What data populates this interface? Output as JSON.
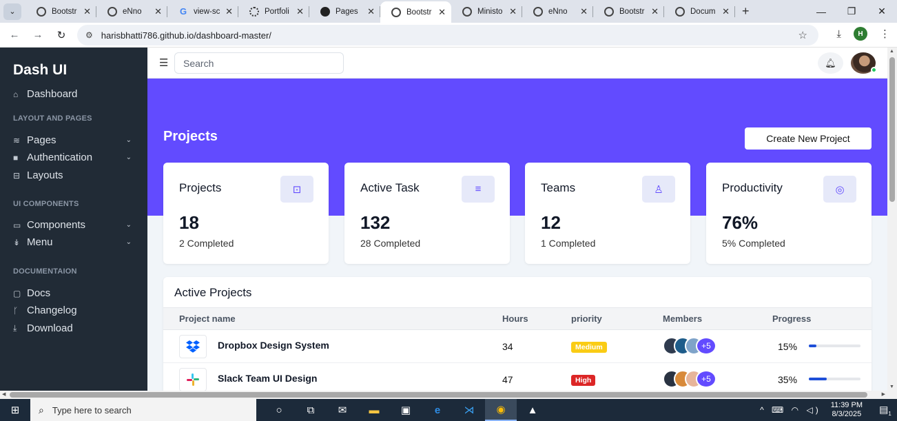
{
  "browser": {
    "tabs": [
      {
        "title": "Bootstr",
        "icon": "globe-icon"
      },
      {
        "title": "eNno",
        "icon": "globe-icon"
      },
      {
        "title": "view-sc",
        "icon": "google-icon"
      },
      {
        "title": "Portfoli",
        "icon": "portfolio-icon"
      },
      {
        "title": "Pages",
        "icon": "github-icon"
      },
      {
        "title": "Bootstr",
        "icon": "globe-icon",
        "active": true
      },
      {
        "title": "Ministo",
        "icon": "globe-icon"
      },
      {
        "title": "eNno",
        "icon": "globe-icon"
      },
      {
        "title": "Bootstr",
        "icon": "globe-icon"
      },
      {
        "title": "Docum",
        "icon": "globe-icon"
      }
    ],
    "url": "harisbhatti786.github.io/dashboard-master/",
    "profile_initial": "H"
  },
  "sidebar": {
    "brand": "Dash UI",
    "dashboard": "Dashboard",
    "section_layout": "LAYOUT AND PAGES",
    "pages": "Pages",
    "authentication": "Authentication",
    "layouts": "Layouts",
    "section_ui": "UI COMPONENTS",
    "components": "Components",
    "menu": "Menu",
    "section_docs": "DOCUMENTAION",
    "docs": "Docs",
    "changelog": "Changelog",
    "download": "Download"
  },
  "topnav": {
    "search_placeholder": "Search"
  },
  "main": {
    "title": "Projects",
    "create_button": "Create New Project",
    "accent_color": "#624bff",
    "cards": [
      {
        "title": "Projects",
        "value": "18",
        "sub": "2 Completed",
        "icon": "briefcase-icon"
      },
      {
        "title": "Active Task",
        "value": "132",
        "sub": "28 Completed",
        "icon": "list-icon"
      },
      {
        "title": "Teams",
        "value": "12",
        "sub": "1 Completed",
        "icon": "user-icon"
      },
      {
        "title": "Productivity",
        "value": "76%",
        "sub": "5% Completed",
        "icon": "target-icon"
      }
    ],
    "active_projects": {
      "title": "Active Projects",
      "columns": [
        "Project name",
        "Hours",
        "priority",
        "Members",
        "Progress"
      ],
      "rows": [
        {
          "name": "Dropbox Design System",
          "hours": "34",
          "priority": "Medium",
          "priority_color": "#facc15",
          "members_more": "+5",
          "progress_label": "15%",
          "progress": 0.15,
          "logo": "dropbox-icon"
        },
        {
          "name": "Slack Team UI Design",
          "hours": "47",
          "priority": "High",
          "priority_color": "#dc2626",
          "members_more": "+5",
          "progress_label": "35%",
          "progress": 0.35,
          "logo": "slack-icon"
        }
      ]
    }
  },
  "taskbar": {
    "search_placeholder": "Type here to search",
    "time": "11:39 PM",
    "date": "8/3/2025",
    "notification_count": "1"
  }
}
